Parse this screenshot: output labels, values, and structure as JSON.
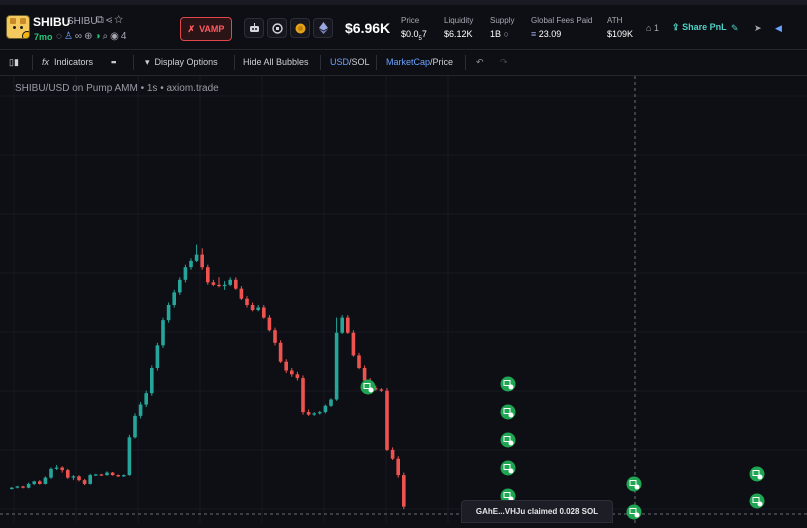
{
  "token": {
    "name": "SHIBU",
    "symbol": "SHIBU",
    "age": "7mo",
    "holders_count": "4",
    "vamp_label": "VAMP"
  },
  "header": {
    "market_cap": "$6.96K",
    "stats": [
      {
        "label": "Price",
        "value_prefix": "$0.0",
        "value_sub": "5",
        "value_suffix": "7"
      },
      {
        "label": "Liquidity",
        "value": "$6.12K"
      },
      {
        "label": "Supply",
        "value": "1B"
      },
      {
        "label": "Global Fees Paid",
        "value": "23.09"
      },
      {
        "label": "ATH",
        "value": "$109K"
      }
    ],
    "watchers": "1",
    "share_label": "Share PnL"
  },
  "toolbar": {
    "indicators": "Indicators",
    "display_options": "Display Options",
    "hide_bubbles": "Hide All Bubbles",
    "usd": "USD",
    "sol": "SOL",
    "marketcap": "MarketCap",
    "price": "Price",
    "slash": "/"
  },
  "chart": {
    "title": "SHIBU/USD on Pump AMM • 1s • axiom.trade",
    "tooltip": "GAhE...VHJu claimed 0.028 SOL"
  },
  "colors": {
    "up": "#26a69a",
    "down": "#ef5350",
    "bubble": "#1fa653",
    "accent": "#6aa2ff",
    "background": "#0e0f14"
  },
  "chart_data": {
    "type": "candlestick",
    "title": "SHIBU/USD on Pump AMM • 1s • axiom.trade",
    "candles": [
      {
        "o": 4,
        "c": 5,
        "h": 5.5,
        "l": 3.5
      },
      {
        "o": 5,
        "c": 6,
        "h": 6.5,
        "l": 4.5
      },
      {
        "o": 6,
        "c": 5,
        "h": 6.5,
        "l": 4.5
      },
      {
        "o": 5,
        "c": 8,
        "h": 9,
        "l": 4.5
      },
      {
        "o": 8,
        "c": 10,
        "h": 10.5,
        "l": 7
      },
      {
        "o": 10,
        "c": 8,
        "h": 11,
        "l": 7.5
      },
      {
        "o": 8,
        "c": 13,
        "h": 14,
        "l": 7.5
      },
      {
        "o": 13,
        "c": 20,
        "h": 21,
        "l": 12
      },
      {
        "o": 20,
        "c": 21,
        "h": 23,
        "l": 19
      },
      {
        "o": 21,
        "c": 19,
        "h": 22,
        "l": 17
      },
      {
        "o": 19,
        "c": 13,
        "h": 20,
        "l": 12
      },
      {
        "o": 13,
        "c": 14,
        "h": 15,
        "l": 11
      },
      {
        "o": 14,
        "c": 11,
        "h": 15,
        "l": 10
      },
      {
        "o": 11,
        "c": 8,
        "h": 12,
        "l": 7
      },
      {
        "o": 8,
        "c": 15,
        "h": 16,
        "l": 7.5
      },
      {
        "o": 15,
        "c": 15.5,
        "h": 16,
        "l": 14.5
      },
      {
        "o": 15.5,
        "c": 15,
        "h": 16,
        "l": 14.5
      },
      {
        "o": 15,
        "c": 17,
        "h": 18,
        "l": 14.5
      },
      {
        "o": 17,
        "c": 15,
        "h": 17.5,
        "l": 14.5
      },
      {
        "o": 15,
        "c": 14,
        "h": 15.5,
        "l": 13.5
      },
      {
        "o": 14,
        "c": 15,
        "h": 15.5,
        "l": 13.5
      },
      {
        "o": 15,
        "c": 45,
        "h": 47,
        "l": 14.5
      },
      {
        "o": 45,
        "c": 62,
        "h": 64,
        "l": 44
      },
      {
        "o": 62,
        "c": 71,
        "h": 73,
        "l": 60
      },
      {
        "o": 71,
        "c": 80,
        "h": 82,
        "l": 69
      },
      {
        "o": 80,
        "c": 100,
        "h": 102,
        "l": 78
      },
      {
        "o": 100,
        "c": 118,
        "h": 120,
        "l": 98
      },
      {
        "o": 118,
        "c": 138,
        "h": 140,
        "l": 116
      },
      {
        "o": 138,
        "c": 150,
        "h": 152,
        "l": 136
      },
      {
        "o": 150,
        "c": 160,
        "h": 162,
        "l": 148
      },
      {
        "o": 160,
        "c": 170,
        "h": 172,
        "l": 158
      },
      {
        "o": 170,
        "c": 180,
        "h": 182,
        "l": 168
      },
      {
        "o": 180,
        "c": 185,
        "h": 187,
        "l": 178
      },
      {
        "o": 185,
        "c": 190,
        "h": 198,
        "l": 184
      },
      {
        "o": 190,
        "c": 180,
        "h": 195,
        "l": 178
      },
      {
        "o": 180,
        "c": 168,
        "h": 182,
        "l": 166
      },
      {
        "o": 168,
        "c": 166,
        "h": 170,
        "l": 165
      },
      {
        "o": 166,
        "c": 165,
        "h": 172,
        "l": 164
      },
      {
        "o": 165,
        "c": 166,
        "h": 169,
        "l": 162
      },
      {
        "o": 166,
        "c": 170,
        "h": 172,
        "l": 165
      },
      {
        "o": 170,
        "c": 163,
        "h": 172,
        "l": 162
      },
      {
        "o": 163,
        "c": 155,
        "h": 165,
        "l": 154
      },
      {
        "o": 155,
        "c": 150,
        "h": 157,
        "l": 148
      },
      {
        "o": 150,
        "c": 146,
        "h": 152,
        "l": 145
      },
      {
        "o": 146,
        "c": 148,
        "h": 150,
        "l": 145
      },
      {
        "o": 148,
        "c": 140,
        "h": 150,
        "l": 139
      },
      {
        "o": 140,
        "c": 130,
        "h": 142,
        "l": 129
      },
      {
        "o": 130,
        "c": 120,
        "h": 132,
        "l": 118
      },
      {
        "o": 120,
        "c": 105,
        "h": 122,
        "l": 104
      },
      {
        "o": 105,
        "c": 98,
        "h": 107,
        "l": 96
      },
      {
        "o": 98,
        "c": 95,
        "h": 100,
        "l": 93
      },
      {
        "o": 95,
        "c": 92,
        "h": 97,
        "l": 90
      },
      {
        "o": 92,
        "c": 65,
        "h": 94,
        "l": 63
      },
      {
        "o": 65,
        "c": 63,
        "h": 67,
        "l": 62
      },
      {
        "o": 63,
        "c": 64,
        "h": 65,
        "l": 62
      },
      {
        "o": 64,
        "c": 65,
        "h": 66,
        "l": 63
      },
      {
        "o": 65,
        "c": 70,
        "h": 71,
        "l": 64
      },
      {
        "o": 70,
        "c": 75,
        "h": 76,
        "l": 69
      },
      {
        "o": 75,
        "c": 128,
        "h": 140,
        "l": 74
      },
      {
        "o": 128,
        "c": 140,
        "h": 142,
        "l": 127
      },
      {
        "o": 140,
        "c": 128,
        "h": 142,
        "l": 127
      },
      {
        "o": 128,
        "c": 110,
        "h": 130,
        "l": 109
      },
      {
        "o": 110,
        "c": 100,
        "h": 112,
        "l": 99
      },
      {
        "o": 100,
        "c": 90,
        "h": 102,
        "l": 89
      },
      {
        "o": 90,
        "c": 84,
        "h": 92,
        "l": 83
      },
      {
        "o": 84,
        "c": 83,
        "h": 86,
        "l": 82
      },
      {
        "o": 83,
        "c": 82,
        "h": 84,
        "l": 81
      },
      {
        "o": 82,
        "c": 35,
        "h": 84,
        "l": 34
      },
      {
        "o": 35,
        "c": 28,
        "h": 37,
        "l": 27
      },
      {
        "o": 28,
        "c": 15,
        "h": 30,
        "l": 13
      },
      {
        "o": 15,
        "c": -10,
        "h": 17,
        "l": -12
      }
    ],
    "bubbles": [
      {
        "index": 49,
        "value": "bubble-1"
      },
      {
        "index": 68,
        "value": "bubble-2"
      },
      {
        "index": 68,
        "value": "bubble-3"
      },
      {
        "index": 68,
        "value": "bubble-4"
      },
      {
        "index": 68,
        "value": "bubble-5"
      },
      {
        "index": 68,
        "value": "bubble-6"
      }
    ]
  }
}
